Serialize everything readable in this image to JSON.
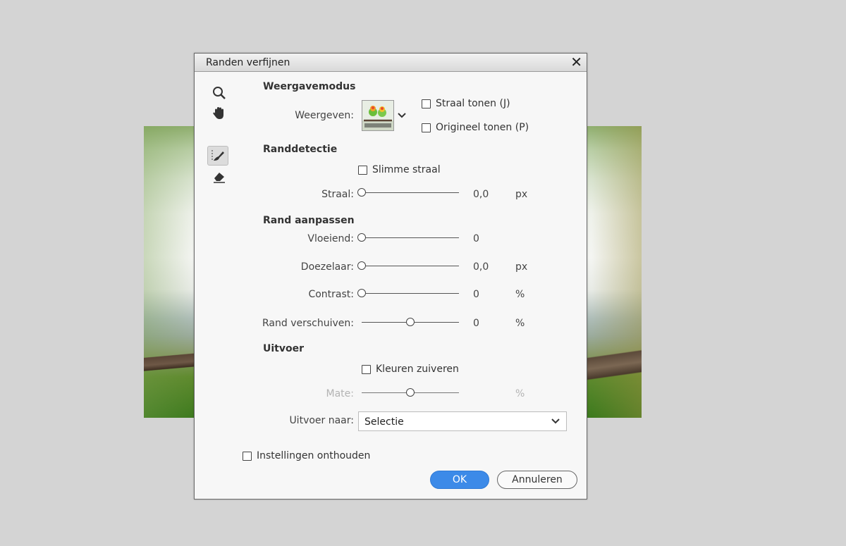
{
  "dialog": {
    "title": "Randen verfijnen",
    "close_icon": "close-icon"
  },
  "tools": [
    {
      "icon": "zoom-icon"
    },
    {
      "icon": "hand-icon"
    },
    {
      "icon": "refine-radius-brush-icon"
    },
    {
      "icon": "erase-refinements-icon"
    }
  ],
  "view_mode": {
    "heading": "Weergavemodus",
    "view_label": "Weergeven:",
    "show_radius": "Straal tonen (J)",
    "show_original": "Origineel tonen (P)"
  },
  "edge_detection": {
    "heading": "Randdetectie",
    "smart_radius": "Slimme straal",
    "radius_label": "Straal:",
    "radius_value": "0,0",
    "radius_unit": "px",
    "radius_fraction": 0
  },
  "adjust_edge": {
    "heading": "Rand aanpassen",
    "smooth_label": "Vloeiend:",
    "smooth_value": "0",
    "smooth_fraction": 0,
    "feather_label": "Doezelaar:",
    "feather_value": "0,0",
    "feather_unit": "px",
    "feather_fraction": 0,
    "contrast_label": "Contrast:",
    "contrast_value": "0",
    "contrast_unit": "%",
    "contrast_fraction": 0,
    "shift_label": "Rand verschuiven:",
    "shift_value": "0",
    "shift_unit": "%",
    "shift_fraction": 0.5
  },
  "output": {
    "heading": "Uitvoer",
    "decontaminate": "Kleuren zuiveren",
    "amount_label": "Mate:",
    "amount_unit": "%",
    "amount_fraction": 0.5,
    "output_to_label": "Uitvoer naar:",
    "output_to_value": "Selectie"
  },
  "footer": {
    "remember": "Instellingen onthouden",
    "ok": "OK",
    "cancel": "Annuleren"
  },
  "colors": {
    "ok_button": "#3c8ae8",
    "background": "#d4d4d4"
  }
}
